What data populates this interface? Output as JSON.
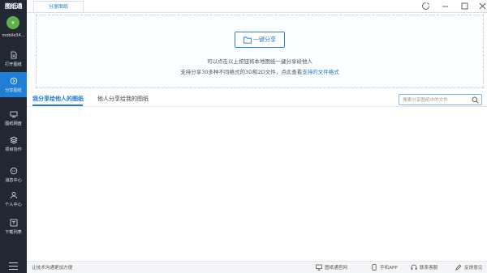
{
  "app": {
    "logo_text": "图纸通",
    "username": "mobile34...",
    "avatar_glyph": "☀"
  },
  "sidebar": {
    "items": [
      {
        "label": "打开图纸",
        "icon": "file-open-icon"
      },
      {
        "label": "分享图纸",
        "icon": "share-icon",
        "active": true
      },
      {
        "label": "图纸网盘",
        "icon": "cloud-drive-icon"
      },
      {
        "label": "项目协作",
        "icon": "layers-icon"
      },
      {
        "label": "消息中心",
        "icon": "message-icon"
      },
      {
        "label": "个人中心",
        "icon": "user-icon"
      },
      {
        "label": "下载列表",
        "icon": "download-list-icon"
      }
    ],
    "menu_icon": "hamburger-icon"
  },
  "tabs": {
    "active_tab": "分享图纸"
  },
  "share": {
    "button_label": "一键分享",
    "desc_line1": "可以点击以上按钮将本地图纸一键分享给他人",
    "desc_line2_prefix": "支持分享30多种不同格式的3D和2D文件，点此查看",
    "desc_line2_link": "支持的文件格式"
  },
  "subtabs": {
    "mine": "我分享给他人的图纸",
    "others": "他人分享给我的图纸"
  },
  "search": {
    "placeholder": "搜索分享图纸中的文件",
    "value": ""
  },
  "status": {
    "message": "让技术沟通更加方便",
    "items": [
      {
        "label": "图纸通官网",
        "icon": "monitor-icon"
      },
      {
        "label": "手机APP",
        "icon": "phone-icon"
      },
      {
        "label": "联系客服",
        "icon": "headset-icon"
      },
      {
        "label": "反馈意见",
        "icon": "feedback-icon"
      }
    ]
  },
  "colors": {
    "accent": "#1f7fd6",
    "sidebar_bg": "#222831",
    "avatar_bg": "#5fb04f"
  }
}
